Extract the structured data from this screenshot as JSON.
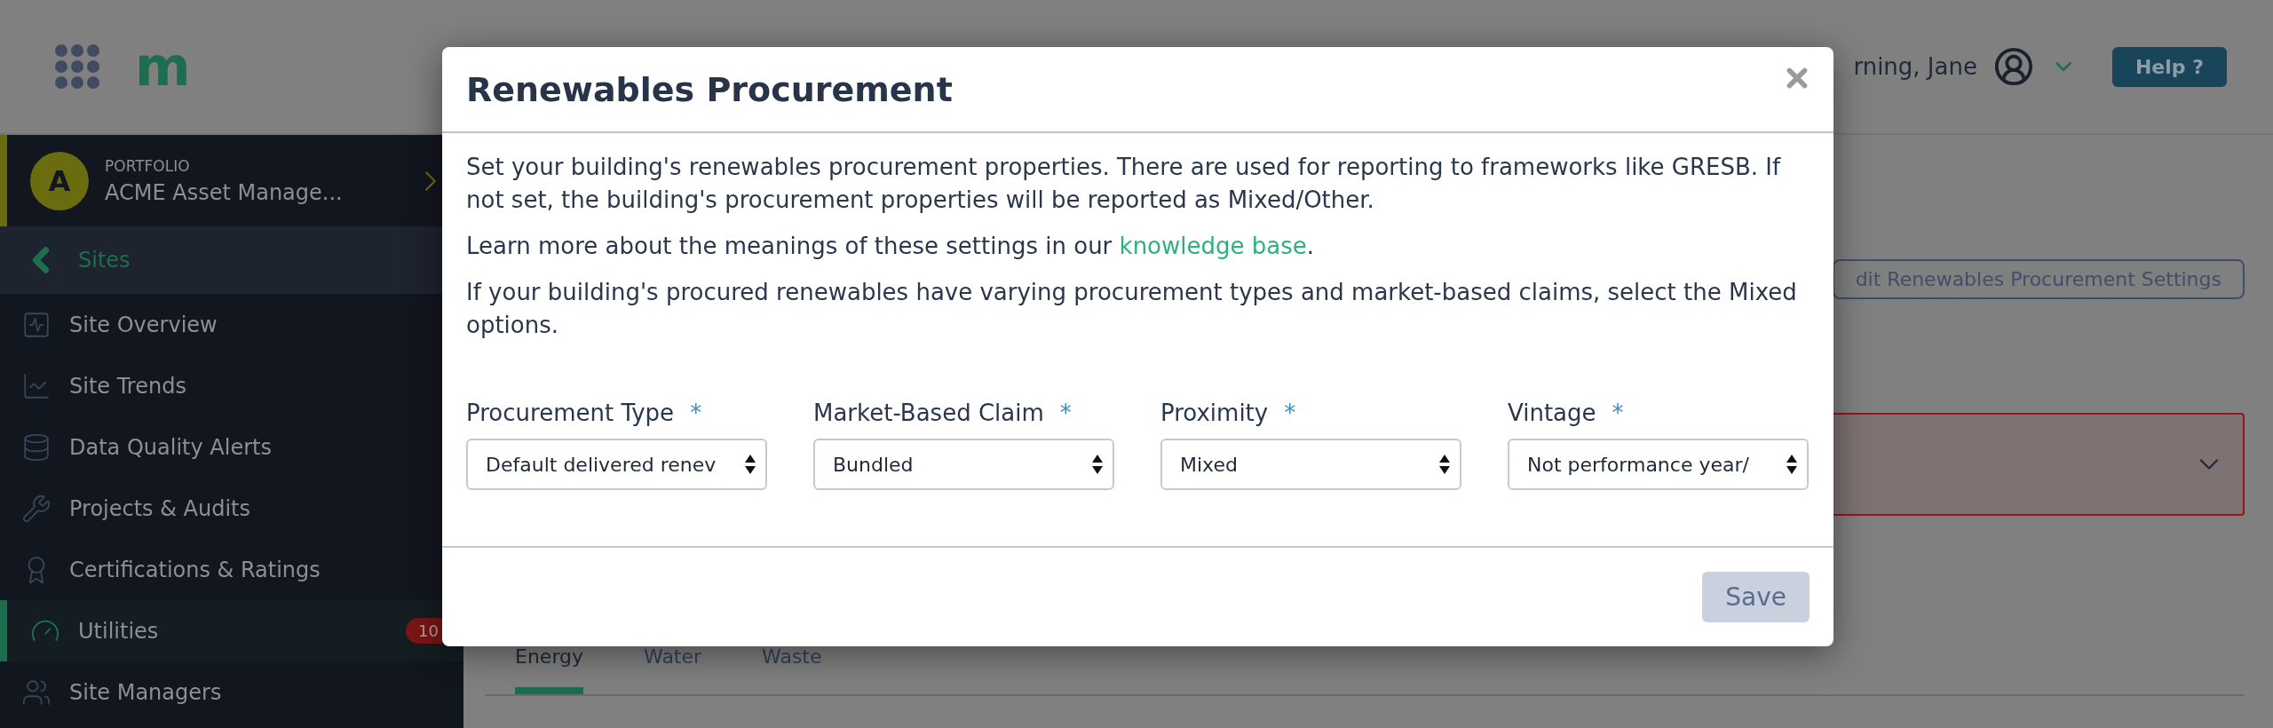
{
  "header": {
    "logo": "m",
    "greeting": "rning, Jane",
    "help_button": "Help ?"
  },
  "sidebar": {
    "portfolio": {
      "avatar": "A",
      "label": "PORTFOLIO",
      "name": "ACME Asset Manage..."
    },
    "back": "Sites",
    "items": [
      {
        "label": "Site Overview",
        "selected": false
      },
      {
        "label": "Site Trends",
        "selected": false
      },
      {
        "label": "Data Quality Alerts",
        "selected": false
      },
      {
        "label": "Projects & Audits",
        "selected": false
      },
      {
        "label": "Certifications & Ratings",
        "selected": false
      },
      {
        "label": "Utilities",
        "selected": true,
        "badge": "10"
      },
      {
        "label": "Site Managers",
        "selected": false
      }
    ]
  },
  "main": {
    "edit_button": "dit Renewables Procurement Settings",
    "tabs": [
      {
        "label": "Energy",
        "selected": true
      },
      {
        "label": "Water",
        "selected": false
      },
      {
        "label": "Waste",
        "selected": false
      }
    ]
  },
  "modal": {
    "title": "Renewables Procurement",
    "intro": "Set your building's renewables procurement properties. There are used for reporting to frameworks like GRESB. If not set, the building's procurement properties will be reported as Mixed/Other.",
    "learn_more": {
      "before": "Learn more about the meanings of these settings in our ",
      "link": "knowledge base",
      "after": "."
    },
    "mixed_note": "If your building's procured renewables have varying procurement types and market-based claims, select the Mixed options.",
    "fields": [
      {
        "label": "Procurement Type",
        "required_mark": "*",
        "value": "Default delivered renev"
      },
      {
        "label": "Market-Based Claim",
        "required_mark": "*",
        "value": "Bundled"
      },
      {
        "label": "Proximity",
        "required_mark": "*",
        "value": "Mixed"
      },
      {
        "label": "Vintage",
        "required_mark": "*",
        "value": "Not performance year/"
      }
    ],
    "save_button": {
      "label": "Save",
      "disabled": true
    }
  }
}
